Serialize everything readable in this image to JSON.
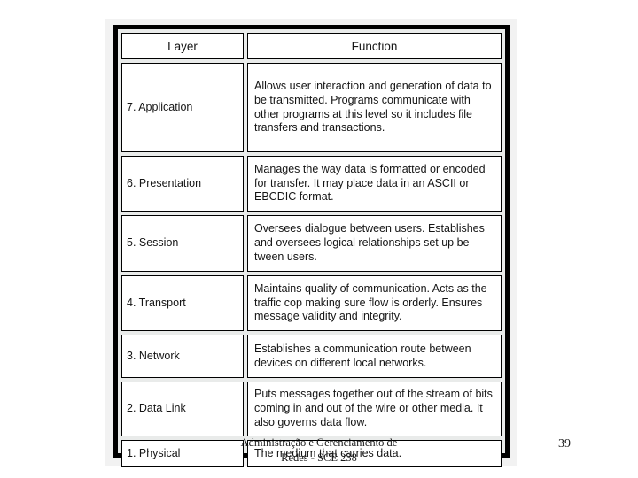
{
  "slide": {
    "number": "39",
    "footer_line1": "Administração e Gerenciamento de",
    "footer_line2": "Redes - SCE 238"
  },
  "table": {
    "headers": {
      "layer": "Layer",
      "function": "Function"
    },
    "rows": [
      {
        "layer": "7. Application",
        "function": "Allows user interaction and generation of data to be transmitted. Programs communicate with other programs at this level so it includes file transfers and transactions."
      },
      {
        "layer": "6. Presentation",
        "function": "Manages the way data is formatted or encoded for transfer. It may place data in an ASCII or EBCDIC format."
      },
      {
        "layer": "5. Session",
        "function": "Oversees dialogue between users. Establishes and oversees logical relationships set up be-tween users."
      },
      {
        "layer": "4. Transport",
        "function": "Maintains quality of communication. Acts as the traffic cop making sure flow is orderly. Ensures message validity and integrity."
      },
      {
        "layer": "3. Network",
        "function": "Establishes a communication route between devices on different local networks."
      },
      {
        "layer": "2. Data Link",
        "function": "Puts messages together out of the stream of bits coming in and out of the wire or other media. It also governs data flow."
      },
      {
        "layer": "1. Physical",
        "function": "The medium that carries data."
      }
    ]
  },
  "colors": {
    "frame": "#000000",
    "cell_border": "#000000",
    "cell_background": "#ffffff",
    "image_background": "#e9ebea",
    "text": "#151515"
  }
}
